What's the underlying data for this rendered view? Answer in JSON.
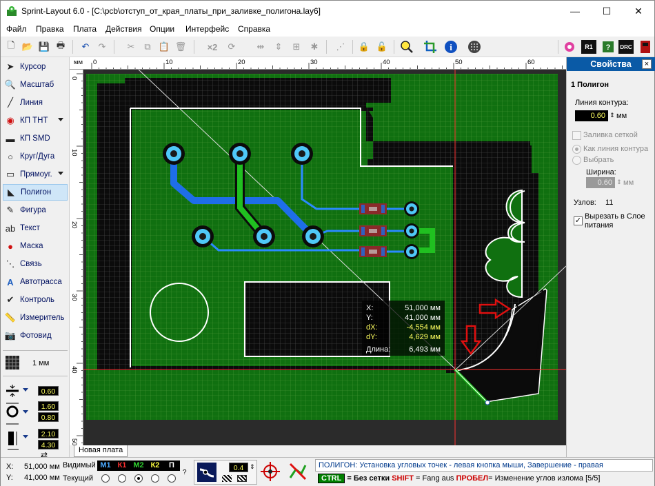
{
  "window": {
    "title": "Sprint-Layout 6.0 - [C:\\pcb\\отступ_от_края_платы_при_заливке_полигона.lay6]",
    "minimize": "—",
    "maximize": "☐",
    "close": "✕"
  },
  "menu": [
    "Файл",
    "Правка",
    "Плата",
    "Действия",
    "Опции",
    "Интерфейс",
    "Справка"
  ],
  "toolbar": {
    "zoom_x2": "×2",
    "right_badges": [
      "R1",
      "DRC"
    ]
  },
  "tools": [
    {
      "label": "Курсор",
      "icon": "cursor-icon"
    },
    {
      "label": "Масштаб",
      "icon": "zoom-icon"
    },
    {
      "label": "Линия",
      "icon": "line-icon"
    },
    {
      "label": "КП ТНТ",
      "icon": "tht-pad-icon",
      "dropdown": true
    },
    {
      "label": "КП SMD",
      "icon": "smd-pad-icon"
    },
    {
      "label": "Круг/Дуга",
      "icon": "circle-icon"
    },
    {
      "label": "Прямоуг.",
      "icon": "rect-icon",
      "dropdown": true
    },
    {
      "label": "Полигон",
      "icon": "polygon-icon",
      "active": true
    },
    {
      "label": "Фигура",
      "icon": "shape-icon"
    },
    {
      "label": "Текст",
      "icon": "text-icon"
    },
    {
      "label": "Маска",
      "icon": "mask-icon"
    },
    {
      "label": "Связь",
      "icon": "connection-icon"
    },
    {
      "label": "Автотрасса",
      "icon": "autoroute-icon"
    },
    {
      "label": "Контроль",
      "icon": "check-icon"
    },
    {
      "label": "Измеритель",
      "icon": "measure-icon"
    },
    {
      "label": "Фотовид",
      "icon": "photoview-icon"
    }
  ],
  "grid": {
    "value": "1 мм"
  },
  "sizes": {
    "track_width": "0.60",
    "pad_outer": "1.60",
    "pad_inner": "0.80",
    "smd_w": "2.10",
    "smd_h": "4.30"
  },
  "ruler": {
    "unit": "мм",
    "top": [
      "0",
      "10",
      "20",
      "30",
      "40",
      "50",
      "60"
    ],
    "left": [
      "0",
      "10",
      "20",
      "30",
      "40",
      "50"
    ]
  },
  "readout": {
    "x_label": "X:",
    "x_value": "51,000 мм",
    "y_label": "Y:",
    "y_value": "41,000 мм",
    "dx_label": "dX:",
    "dx_value": "-4,554 мм",
    "dy_label": "dY:",
    "dy_value": "4,629 мм",
    "len_label": "Длина:",
    "len_value": "6,493 мм"
  },
  "props": {
    "header": "Свойства",
    "close": "×",
    "object": "1 Полигон",
    "contour_label": "Линия контура:",
    "contour_value": "0.60",
    "unit": "мм",
    "grid_fill": "Заливка сеткой",
    "as_contour": "Как линия контура",
    "select": "Выбрать",
    "width_label": "Ширина:",
    "width_value": "0.60",
    "nodes_label": "Узлов:",
    "nodes_value": "11",
    "cut_label": "Вырезать в Слое питания",
    "cut_checked": "✓"
  },
  "board_tab": "Новая плата",
  "status": {
    "x_label": "X:",
    "x_value": "51,000 мм",
    "y_label": "Y:",
    "y_value": "41,000 мм",
    "visible": "Видимый",
    "current": "Текущий",
    "help": "?",
    "layers": [
      {
        "name": "М1",
        "color": "#4aa8ff"
      },
      {
        "name": "К1",
        "color": "#ff3030"
      },
      {
        "name": "М2",
        "color": "#30d030"
      },
      {
        "name": "К2",
        "color": "#ffff40"
      },
      {
        "name": "П",
        "color": "#ffffff"
      }
    ],
    "zoom_value": "0.4",
    "hint1": "ПОЛИГОН:  Установка угловых точек - левая кнопка мыши, Завершение - правая",
    "hint_ctrl": "CTRL",
    "hint_ctrl_txt": " = Без сетки  ",
    "hint_shift": "SHIFT",
    "hint_shift_txt": " = Fang aus  ",
    "hint_space": "ПРОБЕЛ",
    "hint_space_txt": "= Изменение углов излома [5/5]"
  }
}
